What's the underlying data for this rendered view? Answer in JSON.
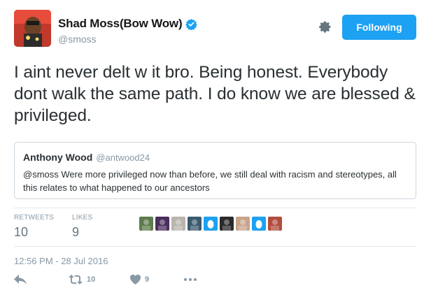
{
  "user": {
    "display_name": "Shad Moss(Bow Wow)",
    "handle": "@smoss",
    "verified": true,
    "avatar_icon": "user-avatar"
  },
  "follow_button": {
    "label": "Following",
    "color": "#1da1f2"
  },
  "settings_icon": "gear-icon",
  "tweet": {
    "text": "I aint never delt w it bro. Being honest. Everybody dont walk the same path. I do know we are blessed & privileged."
  },
  "quoted_tweet": {
    "name": "Anthony Wood",
    "handle": "@antwood24",
    "text": "@smoss  Were more privileged now than before, we still deal with racism and stereotypes, all this relates to what happened to our ancestors"
  },
  "stats": {
    "retweets_label": "RETWEETS",
    "retweets_value": "10",
    "likes_label": "LIKES",
    "likes_value": "9"
  },
  "likers": [
    {
      "icon": "liker-avatar-1",
      "color": "#5d7b4c"
    },
    {
      "icon": "liker-avatar-2",
      "color": "#4a2e5c"
    },
    {
      "icon": "liker-avatar-3",
      "color": "#b9b4ad"
    },
    {
      "icon": "liker-avatar-4",
      "color": "#3b5a6e"
    },
    {
      "icon": "egg-avatar-1",
      "color": "#1da1f2"
    },
    {
      "icon": "liker-avatar-6",
      "color": "#2a2a2a"
    },
    {
      "icon": "liker-avatar-7",
      "color": "#c9a38a"
    },
    {
      "icon": "egg-avatar-2",
      "color": "#1da1f2"
    },
    {
      "icon": "liker-avatar-9",
      "color": "#b24d3d"
    }
  ],
  "timestamp": "12:56 PM - 28 Jul 2016",
  "actions": {
    "reply_icon": "reply-icon",
    "retweet_icon": "retweet-icon",
    "retweet_count": "10",
    "like_icon": "heart-icon",
    "like_count": "9",
    "more_icon": "more-icon"
  }
}
